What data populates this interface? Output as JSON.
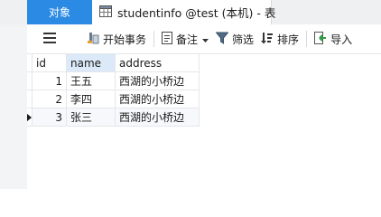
{
  "tabs": {
    "objects_label": "对象",
    "table_tab_label": "studentinfo @test (本机) - 表"
  },
  "toolbar": {
    "begin_transaction": "开始事务",
    "comment": "备注",
    "filter": "筛选",
    "sort": "排序",
    "import": "导入"
  },
  "grid": {
    "columns": [
      "id",
      "name",
      "address"
    ],
    "rows": [
      {
        "id": "1",
        "name": "王五",
        "address": "西湖的小桥边"
      },
      {
        "id": "2",
        "name": "李四",
        "address": "西湖的小桥边"
      },
      {
        "id": "3",
        "name": "张三",
        "address": "西湖的小桥边"
      }
    ],
    "current_row": 3
  },
  "colors": {
    "accent": "#2a8ae4",
    "selected_header": "#dbe9f8"
  },
  "icons": [
    "table-icon",
    "menu-icon",
    "transaction-icon",
    "comment-icon",
    "dropdown-arrow-icon",
    "filter-icon",
    "sort-icon",
    "import-icon",
    "current-row-marker-icon"
  ]
}
